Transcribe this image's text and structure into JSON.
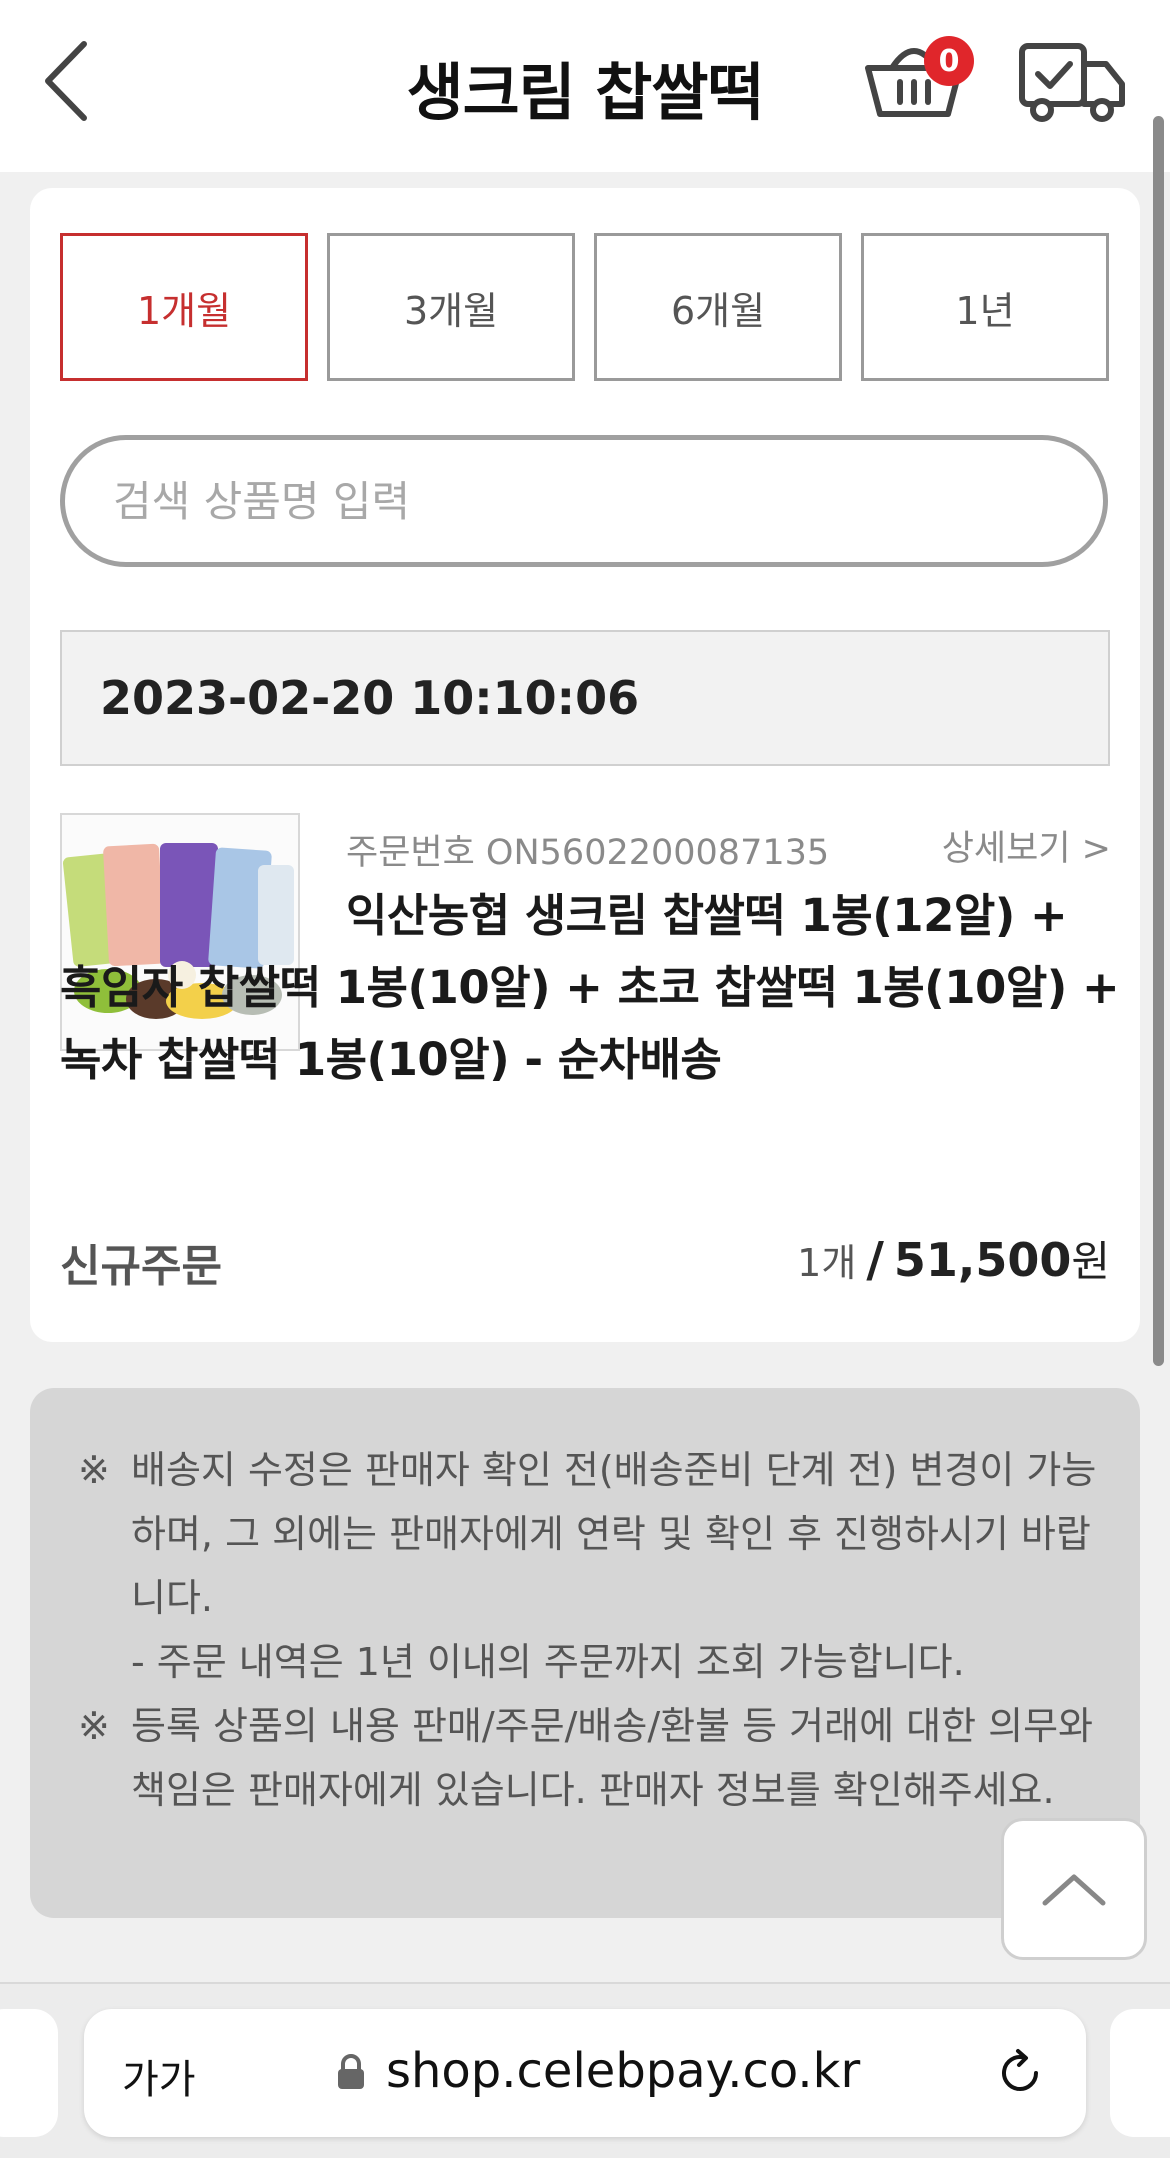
{
  "header": {
    "title": "생크림 찹쌀떡",
    "cart_count": "0"
  },
  "periods": [
    {
      "label": "1개월",
      "active": true
    },
    {
      "label": "3개월",
      "active": false
    },
    {
      "label": "6개월",
      "active": false
    },
    {
      "label": "1년",
      "active": false
    }
  ],
  "search": {
    "placeholder": "검색 상품명 입력",
    "value": ""
  },
  "order": {
    "date": "2023-02-20 10:10:06",
    "number_label": "주문번호 ON5602200087135",
    "detail_link": "상세보기 >",
    "product_name": "익산농협 생크림 찹쌀떡 1봉(12알) + 흑임자 찹쌀떡 1봉(10알) + 초코 찹쌀떡 1봉(10알) + 녹차 찹쌀떡 1봉(10알) - 순차배송",
    "status": "신규주문",
    "quantity": "1개",
    "separator": "/",
    "amount": "51,500",
    "currency": "원"
  },
  "notice": {
    "mark": "※",
    "item1": "배송지 수정은 판매자 확인 전(배송준비 단계 전) 변경이 가능하며, 그 외에는 판매자에게 연락 및 확인 후 진행하시기 바랍니다.",
    "item1_sub": "- 주문 내역은 1년 이내의 주문까지 조회 가능합니다.",
    "item2": "등록 상품의 내용 판매/주문/배송/환불 등 거래에 대한 의무와 책임은 판매자에게 있습니다. 판매자 정보를 확인해주세요."
  },
  "browser": {
    "text_size_label": "가가",
    "url": "shop.celebpay.co.kr"
  },
  "icons": {
    "back": "chevron-left-icon",
    "cart": "basket-icon",
    "delivery": "truck-icon",
    "scroll_top": "chevron-up-icon",
    "lock": "lock-icon",
    "reload": "reload-icon"
  },
  "colors": {
    "accent": "#c62f2f",
    "badge": "#e0262b",
    "notice_bg": "#d6d6d6",
    "page_bg": "#f0f0f0"
  }
}
